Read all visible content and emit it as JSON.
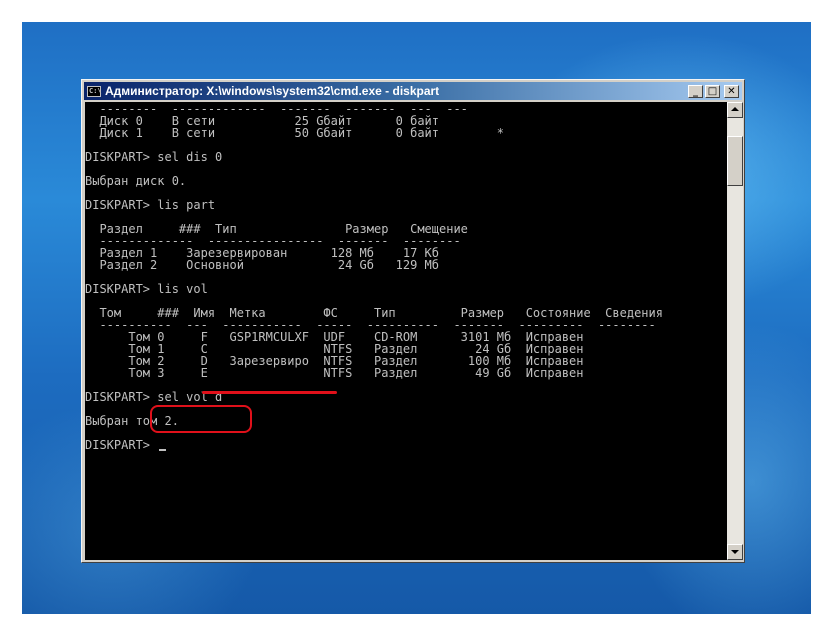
{
  "window": {
    "title": "Администратор: X:\\windows\\system32\\cmd.exe - diskpart",
    "icon_label": "C:\\",
    "minimize_glyph": "_",
    "maximize_glyph": "□",
    "close_glyph": "✕"
  },
  "console": {
    "lines": [
      "  --------  -------------  -------  -------  ---  ---",
      "  Диск 0    В сети           25 Gбайт      0 байт",
      "  Диск 1    В сети           50 Gбайт      0 байт        *",
      "",
      "DISKPART> sel dis 0",
      "",
      "Выбран диск 0.",
      "",
      "DISKPART> lis part",
      "",
      "  Раздел     ###  Тип               Размер   Смещение",
      "  -------------  ----------------  -------  --------",
      "  Раздел 1    Зарезервирован      128 Мб    17 Кб",
      "  Раздел 2    Основной             24 Gб   129 Мб",
      "",
      "DISKPART> lis vol",
      "",
      "  Том     ###  Имя  Метка        ФС     Тип         Размер   Состояние  Сведения",
      "  ----------  ---  -----------  -----  ----------  -------  ---------  --------",
      "      Том 0     F   GSP1RMCULXF  UDF    CD-ROM      3101 Мб  Исправен",
      "      Том 1     C                NTFS   Раздел        24 Gб  Исправен",
      "      Том 2     D   Зарезервиро  NTFS   Раздел       100 Мб  Исправен",
      "      Том 3     E                NTFS   Раздел        49 Gб  Исправен",
      "",
      "DISKPART> sel vol d",
      "",
      "Выбран том 2.",
      "",
      "DISKPART> "
    ]
  },
  "colors": {
    "console_bg": "#000000",
    "console_fg": "#c0c0c0",
    "highlight": "#e0101a",
    "title_start": "#0a246a",
    "title_end": "#a6caf0"
  }
}
